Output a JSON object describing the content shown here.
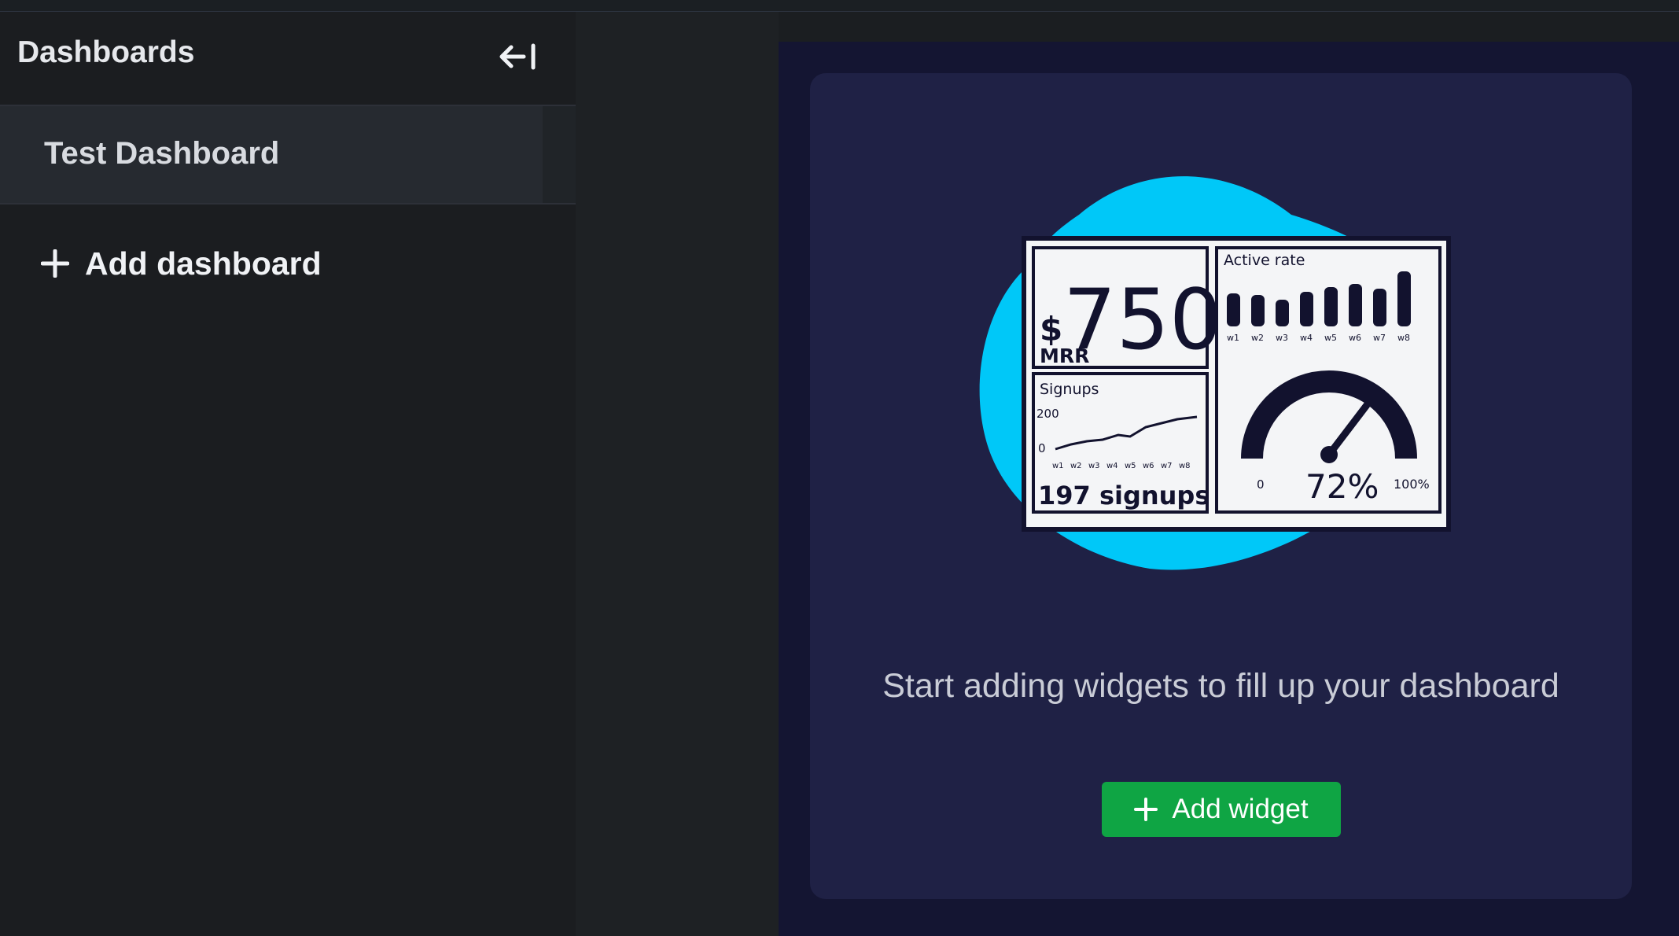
{
  "sidebar": {
    "title": "Dashboards",
    "items": [
      {
        "label": "Test Dashboard"
      }
    ],
    "add_label": "Add dashboard"
  },
  "main": {
    "illustration": {
      "mrr_value": "750",
      "currency": "$",
      "mrr_label": "MRR",
      "active_rate_label": "Active rate",
      "week_labels": [
        "w1",
        "w2",
        "w3",
        "w4",
        "w5",
        "w6",
        "w7",
        "w8"
      ],
      "signups_label": "Signups",
      "signups_axis_max": "200",
      "signups_axis_min": "0",
      "signups_count": "197 signups",
      "gauge_min": "0",
      "gauge_max": "100%",
      "gauge_value": "72%"
    },
    "empty_message": "Start adding widgets to fill up your dashboard",
    "add_widget_label": "Add widget"
  },
  "colors": {
    "accent_green": "#0fa544",
    "blob_cyan": "#00c8f8",
    "main_bg": "#141532",
    "card_bg": "#1f2145"
  }
}
